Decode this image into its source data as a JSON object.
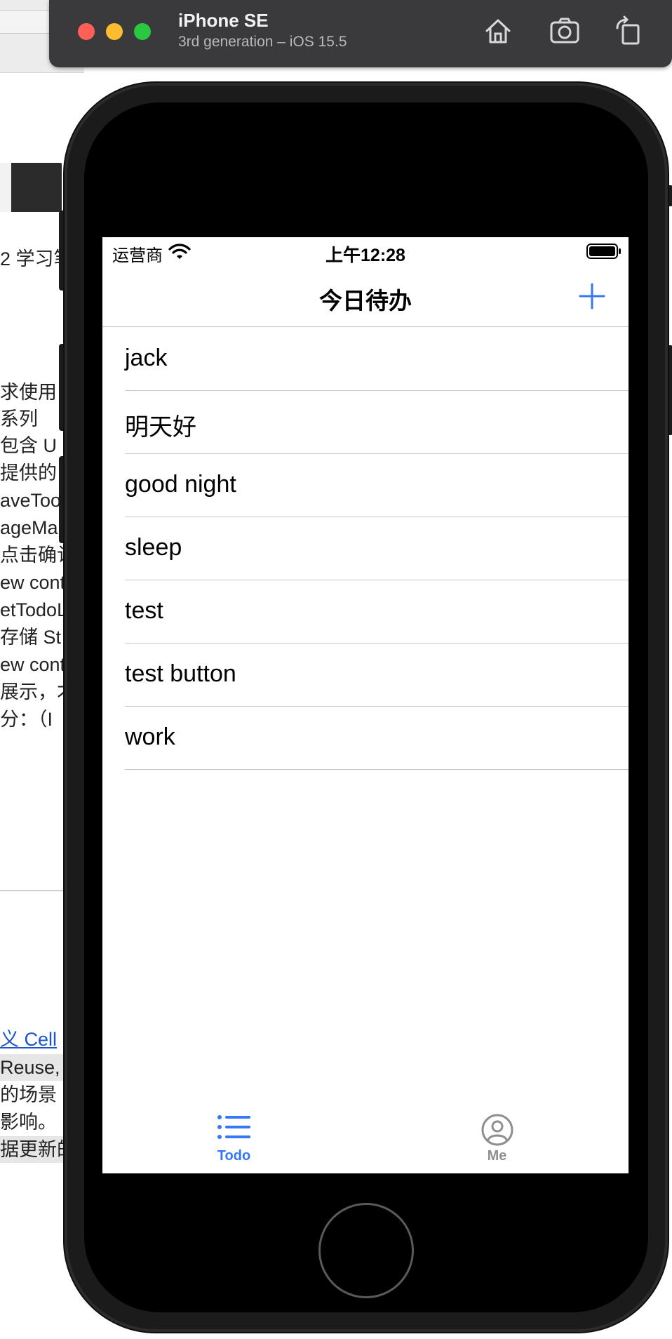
{
  "simulator": {
    "device_name": "iPhone SE",
    "device_detail": "3rd generation – iOS 15.5",
    "buttons": [
      "home-icon",
      "screenshot-icon",
      "rotate-icon"
    ]
  },
  "background_doc": {
    "lines": [
      "2 学习笔",
      "求使用",
      "  系列",
      " 包含 U",
      "提供的",
      "aveToo",
      "ageMa",
      "点击确认",
      "ew cont",
      "etTodoL",
      "存储 St",
      "ew cont",
      "展示，才",
      "分：（I"
    ],
    "link": "义 Cell",
    "lines2": [
      "Reuse,",
      "的场景",
      "影响。",
      "据更新的"
    ]
  },
  "status_bar": {
    "carrier": "运营商",
    "time": "上午12:28"
  },
  "nav": {
    "title": "今日待办",
    "add_icon": "plus-icon"
  },
  "todos": [
    {
      "title": "jack"
    },
    {
      "title": "明天好"
    },
    {
      "title": "good night"
    },
    {
      "title": "sleep"
    },
    {
      "title": "test"
    },
    {
      "title": "test button"
    },
    {
      "title": "work"
    }
  ],
  "tabs": [
    {
      "label": "Todo",
      "icon": "list-icon",
      "selected": true
    },
    {
      "label": "Me",
      "icon": "person-circle-icon",
      "selected": false
    }
  ],
  "colors": {
    "accent": "#3478f6",
    "inactive_tab": "#8e8e93",
    "separator": "#c8c7cc"
  }
}
